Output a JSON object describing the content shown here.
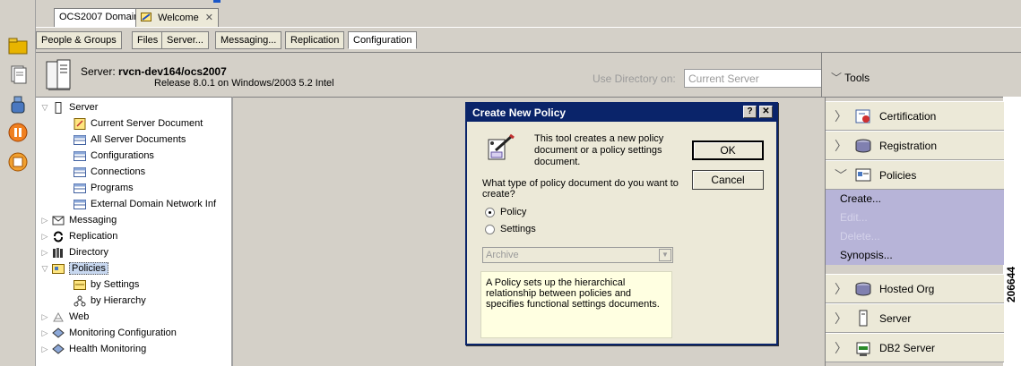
{
  "window_tabs": [
    {
      "label": "OCS2007 Domain",
      "active": true
    },
    {
      "label": "Welcome",
      "active": false
    }
  ],
  "nav_tabs": [
    "People & Groups",
    "Files",
    "Server...",
    "Messaging...",
    "Replication",
    "Configuration"
  ],
  "server_header": {
    "prefix": "Server:",
    "name": "rvcn-dev164/ocs2007",
    "release": "Release 8.0.1 on Windows/2003 5.2 Intel",
    "use_directory_label": "Use Directory on:",
    "use_directory_value": "Current Server"
  },
  "tools_label": "Tools",
  "tree": [
    {
      "label": "Server",
      "level": 0,
      "expanded": true
    },
    {
      "label": "Current Server Document",
      "level": 1
    },
    {
      "label": "All Server Documents",
      "level": 1
    },
    {
      "label": "Configurations",
      "level": 1
    },
    {
      "label": "Connections",
      "level": 1
    },
    {
      "label": "Programs",
      "level": 1
    },
    {
      "label": "External Domain Network Inf",
      "level": 1
    },
    {
      "label": "Messaging",
      "level": 0,
      "expanded": false
    },
    {
      "label": "Replication",
      "level": 0,
      "expanded": false
    },
    {
      "label": "Directory",
      "level": 0,
      "expanded": false
    },
    {
      "label": "Policies",
      "level": 0,
      "expanded": true,
      "selected": true
    },
    {
      "label": "by Settings",
      "level": 1
    },
    {
      "label": "by Hierarchy",
      "level": 1
    },
    {
      "label": "Web",
      "level": 0,
      "expanded": false
    },
    {
      "label": "Monitoring Configuration",
      "level": 0,
      "expanded": false
    },
    {
      "label": "Health Monitoring",
      "level": 0,
      "expanded": false
    }
  ],
  "dialog": {
    "title": "Create New Policy",
    "help_glyph": "?",
    "close_glyph": "✕",
    "description": "This tool creates a new policy document or a policy settings document.",
    "ok_label": "OK",
    "cancel_label": "Cancel",
    "question": "What type of policy document do you want to create?",
    "options": [
      {
        "label": "Policy",
        "checked": true
      },
      {
        "label": "Settings",
        "checked": false
      }
    ],
    "select_value": "Archive",
    "info": "A Policy sets up the hierarchical relationship between policies and specifies functional settings documents."
  },
  "right_panel": {
    "items_top": [
      "Certification",
      "Registration",
      "Policies"
    ],
    "actions": [
      {
        "label": "Create...",
        "enabled": true
      },
      {
        "label": "Edit...",
        "enabled": false
      },
      {
        "label": "Delete...",
        "enabled": false
      },
      {
        "label": "Synopsis...",
        "enabled": true
      }
    ],
    "items_bottom": [
      "Hosted Org",
      "Server",
      "DB2 Server"
    ]
  },
  "figure_id": "206644",
  "colors": {
    "dialog_title_bg": "#0a246a",
    "actions_bg": "#b7b4d8",
    "info_bg": "#ffffe1"
  }
}
